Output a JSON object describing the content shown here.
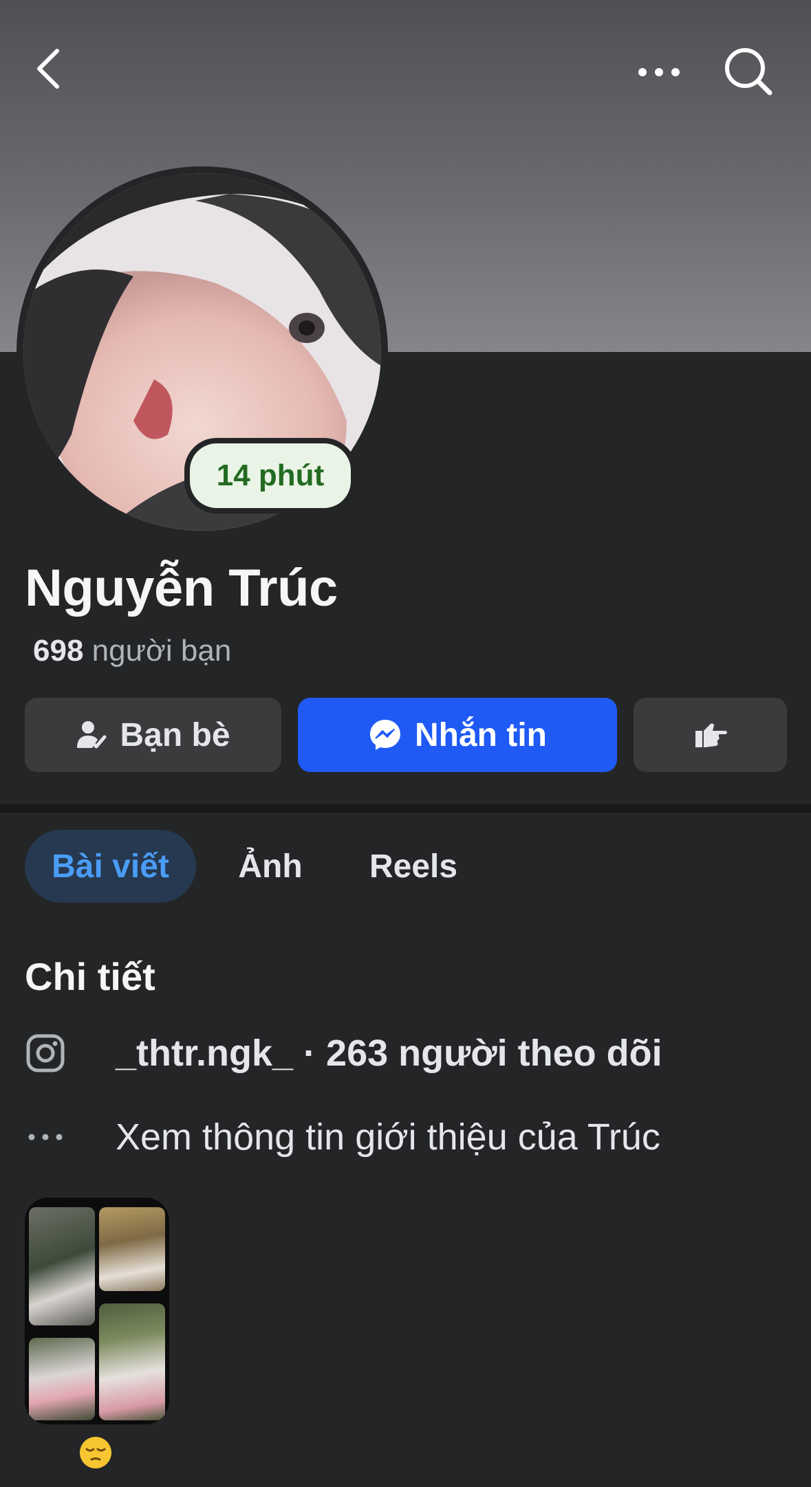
{
  "header": {
    "back_icon": "chevron-left-icon",
    "more_icon": "more-horizontal-icon",
    "search_icon": "search-icon"
  },
  "profile": {
    "name": "Nguyễn Trúc",
    "active_status": "14 phút",
    "friends_count": "698",
    "friends_label": "người bạn"
  },
  "actions": {
    "friends_label": "Bạn bè",
    "message_label": "Nhắn tin",
    "poke_icon": "poke-hand-icon",
    "accent_color": "#1f5af5"
  },
  "tabs": [
    {
      "label": "Bài viết",
      "active": true
    },
    {
      "label": "Ảnh",
      "active": false
    },
    {
      "label": "Reels",
      "active": false
    }
  ],
  "details": {
    "title": "Chi tiết",
    "instagram": "_thtr.ngk_ · 263 người theo dõi",
    "about": "Xem thông tin giới thiệu của Trúc"
  },
  "featured": {
    "caption_icon": "sleepy-face-emoji"
  }
}
